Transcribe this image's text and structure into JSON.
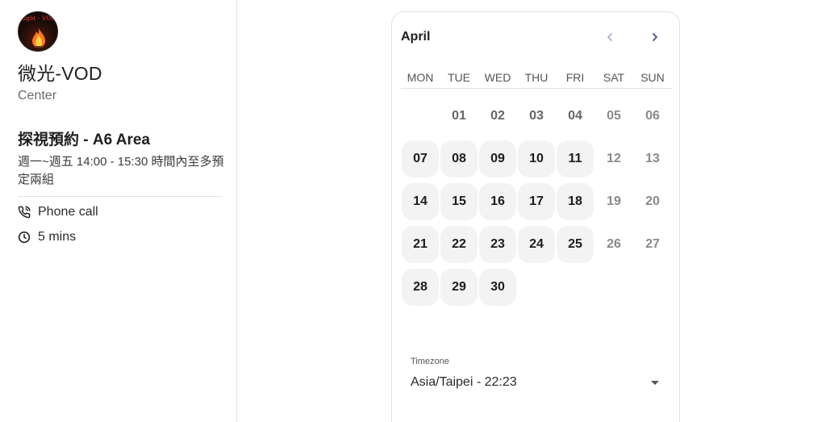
{
  "profile": {
    "avatar_text": "Light - VOD",
    "name": "微光-VOD",
    "subtitle": "Center"
  },
  "event": {
    "title": "探視預約 - A6 Area",
    "description": "週一~週五 14:00 - 15:30 時間內至多預定兩組",
    "location_label": "Phone call",
    "duration_label": "5 mins"
  },
  "calendar": {
    "month": "April",
    "prev_icon": "chevron-left-icon",
    "next_icon": "chevron-right-icon",
    "weekdays": [
      "MON",
      "TUE",
      "WED",
      "THU",
      "FRI",
      "SAT",
      "SUN"
    ],
    "leading_blanks": 1,
    "days": [
      {
        "label": "01",
        "available": false
      },
      {
        "label": "02",
        "available": false
      },
      {
        "label": "03",
        "available": false
      },
      {
        "label": "04",
        "available": false
      },
      {
        "label": "05",
        "available": false
      },
      {
        "label": "06",
        "available": false
      },
      {
        "label": "07",
        "available": true
      },
      {
        "label": "08",
        "available": true
      },
      {
        "label": "09",
        "available": true
      },
      {
        "label": "10",
        "available": true
      },
      {
        "label": "11",
        "available": true
      },
      {
        "label": "12",
        "available": false
      },
      {
        "label": "13",
        "available": false
      },
      {
        "label": "14",
        "available": true
      },
      {
        "label": "15",
        "available": true
      },
      {
        "label": "16",
        "available": true
      },
      {
        "label": "17",
        "available": true
      },
      {
        "label": "18",
        "available": true
      },
      {
        "label": "19",
        "available": false
      },
      {
        "label": "20",
        "available": false
      },
      {
        "label": "21",
        "available": true
      },
      {
        "label": "22",
        "available": true
      },
      {
        "label": "23",
        "available": true
      },
      {
        "label": "24",
        "available": true
      },
      {
        "label": "25",
        "available": true
      },
      {
        "label": "26",
        "available": false
      },
      {
        "label": "27",
        "available": false
      },
      {
        "label": "28",
        "available": true
      },
      {
        "label": "29",
        "available": true
      },
      {
        "label": "30",
        "available": true
      }
    ]
  },
  "timezone": {
    "label": "Timezone",
    "value": "Asia/Taipei - 22:23"
  },
  "colors": {
    "available_bg": "#f3f3f3",
    "nav_prev": "#b0b0d0",
    "nav_next": "#4a4f9a"
  }
}
